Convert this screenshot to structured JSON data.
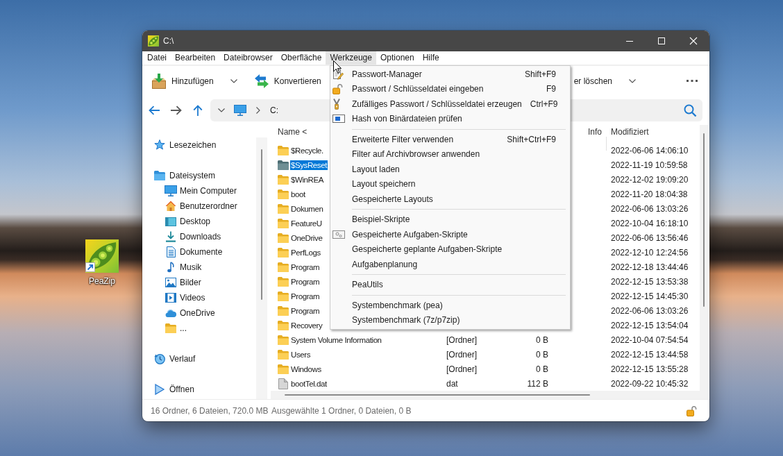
{
  "desktop": {
    "icons": [
      {
        "label": "PeaZip"
      }
    ]
  },
  "window": {
    "title": "C:\\"
  },
  "menu_bar": [
    {
      "label": "Datei",
      "selected": false
    },
    {
      "label": "Bearbeiten",
      "selected": false
    },
    {
      "label": "Dateibrowser",
      "selected": false
    },
    {
      "label": "Oberfläche",
      "selected": false
    },
    {
      "label": "Werkzeuge",
      "selected": true
    },
    {
      "label": "Optionen",
      "selected": false
    },
    {
      "label": "Hilfe",
      "selected": false
    }
  ],
  "toolbar": {
    "buttons": [
      {
        "label": "Hinzufügen",
        "dropdown": true
      },
      {
        "label": "Konvertieren",
        "dropdown": false
      },
      {
        "label": "er löschen",
        "dropdown": true
      }
    ]
  },
  "address_bar": {
    "path": "C:"
  },
  "sidebar": {
    "items": [
      {
        "label": "Lesezeichen"
      },
      {
        "label": "Dateisystem",
        "children": [
          {
            "label": "Mein Computer"
          },
          {
            "label": "Benutzerordner"
          },
          {
            "label": "Desktop"
          },
          {
            "label": "Downloads"
          },
          {
            "label": "Dokumente"
          },
          {
            "label": "Musik"
          },
          {
            "label": "Bilder"
          },
          {
            "label": "Videos"
          },
          {
            "label": "OneDrive"
          },
          {
            "label": "..."
          }
        ]
      },
      {
        "label": "Verlauf"
      },
      {
        "label": "Öffnen"
      }
    ]
  },
  "file_list": {
    "columns": [
      {
        "label": "Name <"
      },
      {
        "label": "Info"
      },
      {
        "label": "Modifiziert"
      }
    ],
    "rows": [
      {
        "kind": "folder",
        "name": "$Recycle.",
        "modified": "2022-06-06 14:06:10",
        "selected": false
      },
      {
        "kind": "folder",
        "name": "$SysReset",
        "modified": "2022-11-19 10:59:58",
        "selected": true
      },
      {
        "kind": "folder",
        "name": "$WinREA",
        "modified": "2022-12-02 19:09:20",
        "selected": false
      },
      {
        "kind": "folder",
        "name": "boot",
        "modified": "2022-11-20 18:04:38",
        "selected": false
      },
      {
        "kind": "folder",
        "name": "Dokumen",
        "modified": "2022-06-06 13:03:26",
        "selected": false
      },
      {
        "kind": "folder",
        "name": "FeatureU",
        "modified": "2022-10-04 16:18:10",
        "selected": false
      },
      {
        "kind": "folder",
        "name": "OneDrive",
        "modified": "2022-06-06 13:56:46",
        "selected": false
      },
      {
        "kind": "folder",
        "name": "PerfLogs",
        "modified": "2022-12-10 12:24:56",
        "selected": false
      },
      {
        "kind": "folder",
        "name": "Program",
        "modified": "2022-12-18 13:44:46",
        "selected": false
      },
      {
        "kind": "folder",
        "name": "Program",
        "modified": "2022-12-15 13:53:38",
        "selected": false
      },
      {
        "kind": "folder",
        "name": "Program",
        "modified": "2022-12-15 14:45:30",
        "selected": false
      },
      {
        "kind": "folder",
        "name": "Program",
        "modified": "2022-06-06 13:03:26",
        "selected": false
      },
      {
        "kind": "folder",
        "name": "Recovery",
        "modified": "2022-12-15 13:54:04",
        "selected": false
      },
      {
        "kind": "folder",
        "name": "System Volume Information",
        "column_2": "[Ordner]",
        "column_3": "0 B",
        "modified": "2022-10-04 07:54:54",
        "selected": false
      },
      {
        "kind": "folder",
        "name": "Users",
        "column_2": "[Ordner]",
        "column_3": "0 B",
        "modified": "2022-12-15 13:44:58",
        "selected": false
      },
      {
        "kind": "folder",
        "name": "Windows",
        "column_2": "[Ordner]",
        "column_3": "0 B",
        "modified": "2022-12-15 13:55:28",
        "selected": false
      },
      {
        "kind": "file",
        "name": "bootTel.dat",
        "column_2": "dat",
        "column_3": "112 B",
        "modified": "2022-09-22 10:45:32",
        "selected": false
      }
    ]
  },
  "status_bar": {
    "summary": "16 Ordner, 6 Dateien, 720.0 MB",
    "selection": "Ausgewählte 1 Ordner, 0 Dateien, 0 B"
  },
  "dropdown_menu": {
    "items": [
      {
        "kind": "item",
        "label": "Passwort-Manager",
        "shortcut": "Shift+F9"
      },
      {
        "kind": "item",
        "label": "Passwort / Schlüsseldatei eingeben",
        "shortcut": "F9"
      },
      {
        "kind": "item",
        "label": "Zufälliges Passwort / Schlüsseldatei erzeugen",
        "shortcut": "Ctrl+F9"
      },
      {
        "kind": "item",
        "label": "Hash von Binärdateien prüfen"
      },
      {
        "kind": "separator"
      },
      {
        "kind": "item",
        "label": "Erweiterte Filter verwenden",
        "shortcut": "Shift+Ctrl+F9"
      },
      {
        "kind": "item",
        "label": "Filter auf Archivbrowser anwenden"
      },
      {
        "kind": "item",
        "label": "Layout laden"
      },
      {
        "kind": "item",
        "label": "Layout speichern"
      },
      {
        "kind": "item",
        "label": "Gespeicherte Layouts"
      },
      {
        "kind": "separator"
      },
      {
        "kind": "item",
        "label": "Beispiel-Skripte"
      },
      {
        "kind": "item",
        "label": "Gespeicherte Aufgaben-Skripte"
      },
      {
        "kind": "item",
        "label": "Gespeicherte geplante Aufgaben-Skripte"
      },
      {
        "kind": "item",
        "label": "Aufgabenplanung"
      },
      {
        "kind": "separator"
      },
      {
        "kind": "item",
        "label": "PeaUtils"
      },
      {
        "kind": "separator"
      },
      {
        "kind": "item",
        "label": "Systembenchmark (pea)"
      },
      {
        "kind": "item",
        "label": "Systembenchmark (7z/p7zip)"
      }
    ]
  }
}
